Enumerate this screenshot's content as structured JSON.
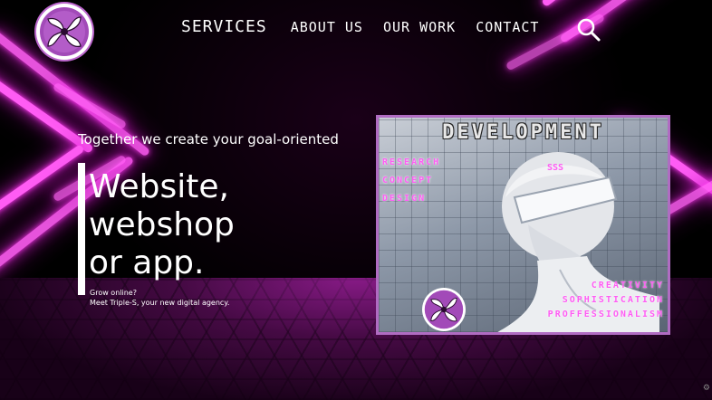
{
  "nav": {
    "items": [
      {
        "label": "SERVICES"
      },
      {
        "label": "ABOUT US"
      },
      {
        "label": "OUR WORK"
      },
      {
        "label": "CONTACT"
      }
    ],
    "search_icon": "search-icon"
  },
  "hero": {
    "subheading": "Together we create your goal-oriented",
    "title_line1": "Website,",
    "title_line2": "webshop",
    "title_line3": "or app.",
    "tagline_line1": "Grow online?",
    "tagline_line2": "Meet Triple-S, your new digital agency."
  },
  "promo": {
    "title": "DEVELOPMENT",
    "left_items": [
      "RESEARCH",
      "CONCEPT",
      "DESIGN"
    ],
    "badge": "SSS",
    "right_items": [
      "CREATIVITY",
      "SOPHISTICATION",
      "PROFFESSIONALISM"
    ]
  },
  "colors": {
    "neon": "#ff5cf4",
    "logo_purple": "#a24ab8",
    "text": "#ffffff"
  }
}
